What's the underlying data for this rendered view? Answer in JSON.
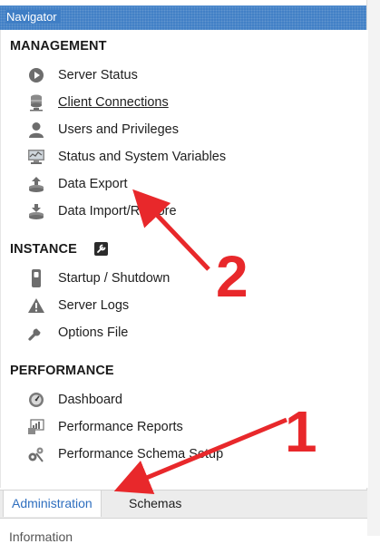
{
  "window": {
    "title": "Navigator"
  },
  "sections": {
    "management": {
      "header": "MANAGEMENT",
      "items": [
        {
          "label": "Server Status",
          "icon": "play-circle-icon"
        },
        {
          "label": "Client Connections",
          "icon": "database-user-icon"
        },
        {
          "label": "Users and Privileges",
          "icon": "user-icon"
        },
        {
          "label": "Status and System Variables",
          "icon": "monitor-icon"
        },
        {
          "label": "Data Export",
          "icon": "export-icon"
        },
        {
          "label": "Data Import/Restore",
          "icon": "import-icon"
        }
      ]
    },
    "instance": {
      "header": "INSTANCE",
      "header_icon": "wrench-box-icon",
      "items": [
        {
          "label": "Startup / Shutdown",
          "icon": "power-switch-icon"
        },
        {
          "label": "Server Logs",
          "icon": "warning-icon"
        },
        {
          "label": "Options File",
          "icon": "wrench-icon"
        }
      ]
    },
    "performance": {
      "header": "PERFORMANCE",
      "items": [
        {
          "label": "Dashboard",
          "icon": "gauge-icon"
        },
        {
          "label": "Performance Reports",
          "icon": "reports-icon"
        },
        {
          "label": "Performance Schema Setup",
          "icon": "gears-icon"
        }
      ]
    }
  },
  "tabs": [
    {
      "label": "Administration",
      "active": true
    },
    {
      "label": "Schemas",
      "active": false
    }
  ],
  "bottom": {
    "label": "Information"
  },
  "annotations": [
    {
      "number": "1",
      "color": "#e8282b"
    },
    {
      "number": "2",
      "color": "#e8282b"
    }
  ],
  "colors": {
    "titlebar": "#3f7ec5",
    "active_tab_text": "#2f6fbf",
    "annotation": "#e8282b"
  }
}
